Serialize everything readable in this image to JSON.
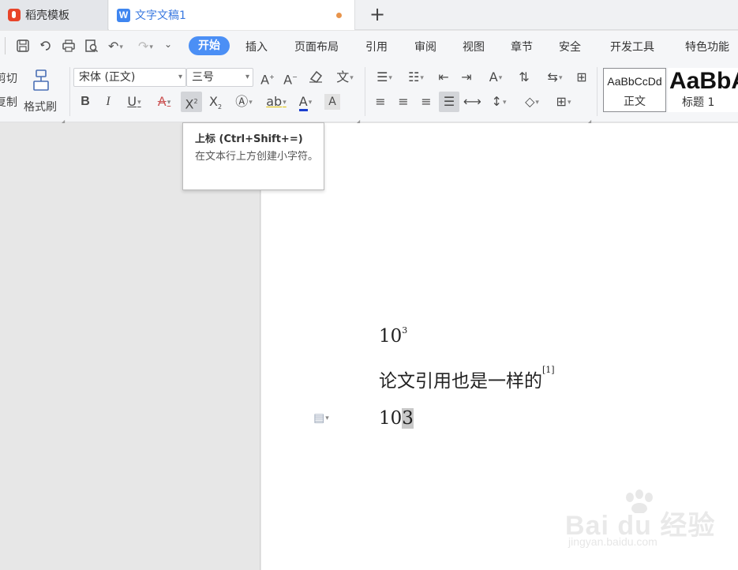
{
  "tabs": [
    {
      "label": "稻壳模板"
    },
    {
      "label": "文字文稿1"
    }
  ],
  "menu": {
    "items": [
      "开始",
      "插入",
      "页面布局",
      "引用",
      "审阅",
      "视图",
      "章节",
      "安全",
      "开发工具",
      "特色功能"
    ]
  },
  "clipboard": {
    "cut": "剪切",
    "copy": "复制",
    "format_painter": "格式刷"
  },
  "font": {
    "family": "宋体 (正文)",
    "size": "三号"
  },
  "styles": [
    {
      "preview": "AaBbCcDd",
      "name": "正文"
    },
    {
      "preview": "AaBbA",
      "name": "标题 1"
    }
  ],
  "tooltip": {
    "title": "上标 (Ctrl+Shift+=)",
    "description": "在文本行上方创建小字符。"
  },
  "document": {
    "line1_base": "10",
    "line1_sup": "3",
    "line2_text": "论文引用也是一样的",
    "line2_sup": "[1]",
    "line3_base": "10",
    "line3_selected": "3"
  },
  "watermark": {
    "brand": "Bai du 经验",
    "url": "jingyan.baidu.com"
  },
  "colors": {
    "accent": "#4b8ff5",
    "font_color_underline": "#1a3fcf"
  }
}
